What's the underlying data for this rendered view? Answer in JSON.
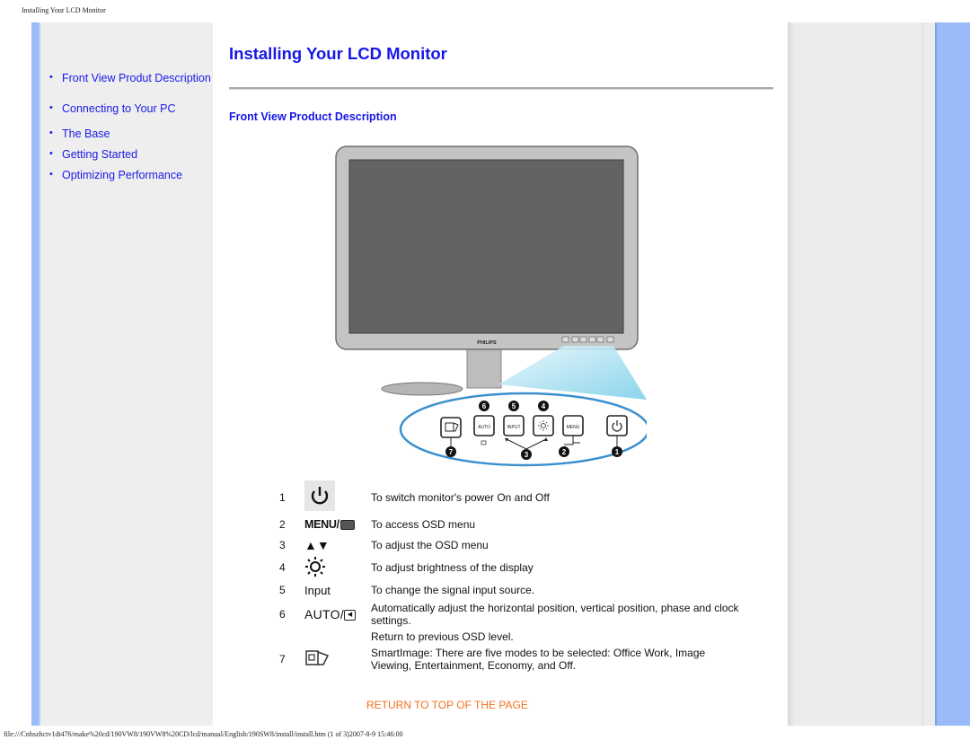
{
  "page": {
    "browser_title": "Installing Your LCD Monitor",
    "footer_path": "file:///Cnhszhctv1dt476/make%20cd/190VW8/190VW8%20CD/lcd/manual/English/190SW8/install/install.htm (1 of 3)2007-8-9 15:46:00"
  },
  "sidebar": {
    "items": [
      {
        "label": "Front View Produt Description"
      },
      {
        "label": "Connecting to Your PC"
      },
      {
        "label": "The Base"
      },
      {
        "label": "Getting Started"
      },
      {
        "label": "Optimizing Performance"
      }
    ]
  },
  "main": {
    "title": "Installing Your LCD Monitor",
    "section_title": "Front View Product Description",
    "figure": {
      "brand": "PHILIPS",
      "buttons": [
        {
          "label": "SmartImage",
          "callout": "7"
        },
        {
          "label": "AUTO",
          "callout": "6"
        },
        {
          "label": "INPUT",
          "callout": "5"
        },
        {
          "label": "brightness",
          "callout": "4"
        },
        {
          "label": "MENU",
          "callout": "2"
        },
        {
          "label": "power",
          "callout": "1"
        }
      ],
      "shared_callout": "3",
      "button_text": {
        "auto": "AUTO",
        "input": "INPUT",
        "menu": "MENU"
      }
    },
    "controls": [
      {
        "num": "1",
        "icon": "power-icon",
        "text": "To switch monitor's power On and Off"
      },
      {
        "num": "2",
        "icon": "menu-ok-icon",
        "icon_text": "MENU/",
        "text": "To access OSD menu"
      },
      {
        "num": "3",
        "icon": "up-down-arrows-icon",
        "icon_text": "▲▼",
        "text": "To adjust the OSD menu"
      },
      {
        "num": "4",
        "icon": "brightness-icon",
        "text": "To adjust brightness of the display"
      },
      {
        "num": "5",
        "icon": "input-label",
        "icon_text": "Input",
        "text": "To change the signal input source."
      },
      {
        "num": "6",
        "icon": "auto-back-icon",
        "icon_text": "AUTO/",
        "text": "Automatically adjust the horizontal position, vertical position, phase and clock settings."
      },
      {
        "num": "",
        "icon": "",
        "text": "Return to previous OSD level."
      },
      {
        "num": "7",
        "icon": "smartimage-icon",
        "text": "SmartImage: There are five modes to be selected: Office Work, Image Viewing, Entertainment, Economy, and Off."
      }
    ],
    "return_link": "RETURN TO TOP OF THE PAGE"
  },
  "colors": {
    "link_blue": "#1a1ae6",
    "return_orange": "#f07020",
    "stripe_blue": "#99bbf7",
    "panel_gray": "#eeeeee"
  }
}
